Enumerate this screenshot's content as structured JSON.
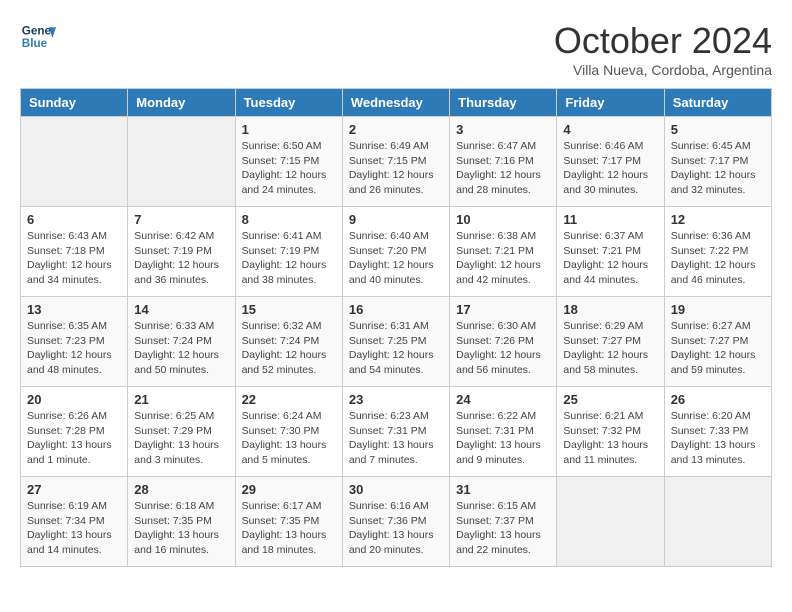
{
  "logo": {
    "line1": "General",
    "line2": "Blue"
  },
  "title": "October 2024",
  "subtitle": "Villa Nueva, Cordoba, Argentina",
  "days_of_week": [
    "Sunday",
    "Monday",
    "Tuesday",
    "Wednesday",
    "Thursday",
    "Friday",
    "Saturday"
  ],
  "weeks": [
    [
      {
        "day": "",
        "info": ""
      },
      {
        "day": "",
        "info": ""
      },
      {
        "day": "1",
        "info": "Sunrise: 6:50 AM\nSunset: 7:15 PM\nDaylight: 12 hours and 24 minutes."
      },
      {
        "day": "2",
        "info": "Sunrise: 6:49 AM\nSunset: 7:15 PM\nDaylight: 12 hours and 26 minutes."
      },
      {
        "day": "3",
        "info": "Sunrise: 6:47 AM\nSunset: 7:16 PM\nDaylight: 12 hours and 28 minutes."
      },
      {
        "day": "4",
        "info": "Sunrise: 6:46 AM\nSunset: 7:17 PM\nDaylight: 12 hours and 30 minutes."
      },
      {
        "day": "5",
        "info": "Sunrise: 6:45 AM\nSunset: 7:17 PM\nDaylight: 12 hours and 32 minutes."
      }
    ],
    [
      {
        "day": "6",
        "info": "Sunrise: 6:43 AM\nSunset: 7:18 PM\nDaylight: 12 hours and 34 minutes."
      },
      {
        "day": "7",
        "info": "Sunrise: 6:42 AM\nSunset: 7:19 PM\nDaylight: 12 hours and 36 minutes."
      },
      {
        "day": "8",
        "info": "Sunrise: 6:41 AM\nSunset: 7:19 PM\nDaylight: 12 hours and 38 minutes."
      },
      {
        "day": "9",
        "info": "Sunrise: 6:40 AM\nSunset: 7:20 PM\nDaylight: 12 hours and 40 minutes."
      },
      {
        "day": "10",
        "info": "Sunrise: 6:38 AM\nSunset: 7:21 PM\nDaylight: 12 hours and 42 minutes."
      },
      {
        "day": "11",
        "info": "Sunrise: 6:37 AM\nSunset: 7:21 PM\nDaylight: 12 hours and 44 minutes."
      },
      {
        "day": "12",
        "info": "Sunrise: 6:36 AM\nSunset: 7:22 PM\nDaylight: 12 hours and 46 minutes."
      }
    ],
    [
      {
        "day": "13",
        "info": "Sunrise: 6:35 AM\nSunset: 7:23 PM\nDaylight: 12 hours and 48 minutes."
      },
      {
        "day": "14",
        "info": "Sunrise: 6:33 AM\nSunset: 7:24 PM\nDaylight: 12 hours and 50 minutes."
      },
      {
        "day": "15",
        "info": "Sunrise: 6:32 AM\nSunset: 7:24 PM\nDaylight: 12 hours and 52 minutes."
      },
      {
        "day": "16",
        "info": "Sunrise: 6:31 AM\nSunset: 7:25 PM\nDaylight: 12 hours and 54 minutes."
      },
      {
        "day": "17",
        "info": "Sunrise: 6:30 AM\nSunset: 7:26 PM\nDaylight: 12 hours and 56 minutes."
      },
      {
        "day": "18",
        "info": "Sunrise: 6:29 AM\nSunset: 7:27 PM\nDaylight: 12 hours and 58 minutes."
      },
      {
        "day": "19",
        "info": "Sunrise: 6:27 AM\nSunset: 7:27 PM\nDaylight: 12 hours and 59 minutes."
      }
    ],
    [
      {
        "day": "20",
        "info": "Sunrise: 6:26 AM\nSunset: 7:28 PM\nDaylight: 13 hours and 1 minute."
      },
      {
        "day": "21",
        "info": "Sunrise: 6:25 AM\nSunset: 7:29 PM\nDaylight: 13 hours and 3 minutes."
      },
      {
        "day": "22",
        "info": "Sunrise: 6:24 AM\nSunset: 7:30 PM\nDaylight: 13 hours and 5 minutes."
      },
      {
        "day": "23",
        "info": "Sunrise: 6:23 AM\nSunset: 7:31 PM\nDaylight: 13 hours and 7 minutes."
      },
      {
        "day": "24",
        "info": "Sunrise: 6:22 AM\nSunset: 7:31 PM\nDaylight: 13 hours and 9 minutes."
      },
      {
        "day": "25",
        "info": "Sunrise: 6:21 AM\nSunset: 7:32 PM\nDaylight: 13 hours and 11 minutes."
      },
      {
        "day": "26",
        "info": "Sunrise: 6:20 AM\nSunset: 7:33 PM\nDaylight: 13 hours and 13 minutes."
      }
    ],
    [
      {
        "day": "27",
        "info": "Sunrise: 6:19 AM\nSunset: 7:34 PM\nDaylight: 13 hours and 14 minutes."
      },
      {
        "day": "28",
        "info": "Sunrise: 6:18 AM\nSunset: 7:35 PM\nDaylight: 13 hours and 16 minutes."
      },
      {
        "day": "29",
        "info": "Sunrise: 6:17 AM\nSunset: 7:35 PM\nDaylight: 13 hours and 18 minutes."
      },
      {
        "day": "30",
        "info": "Sunrise: 6:16 AM\nSunset: 7:36 PM\nDaylight: 13 hours and 20 minutes."
      },
      {
        "day": "31",
        "info": "Sunrise: 6:15 AM\nSunset: 7:37 PM\nDaylight: 13 hours and 22 minutes."
      },
      {
        "day": "",
        "info": ""
      },
      {
        "day": "",
        "info": ""
      }
    ]
  ]
}
